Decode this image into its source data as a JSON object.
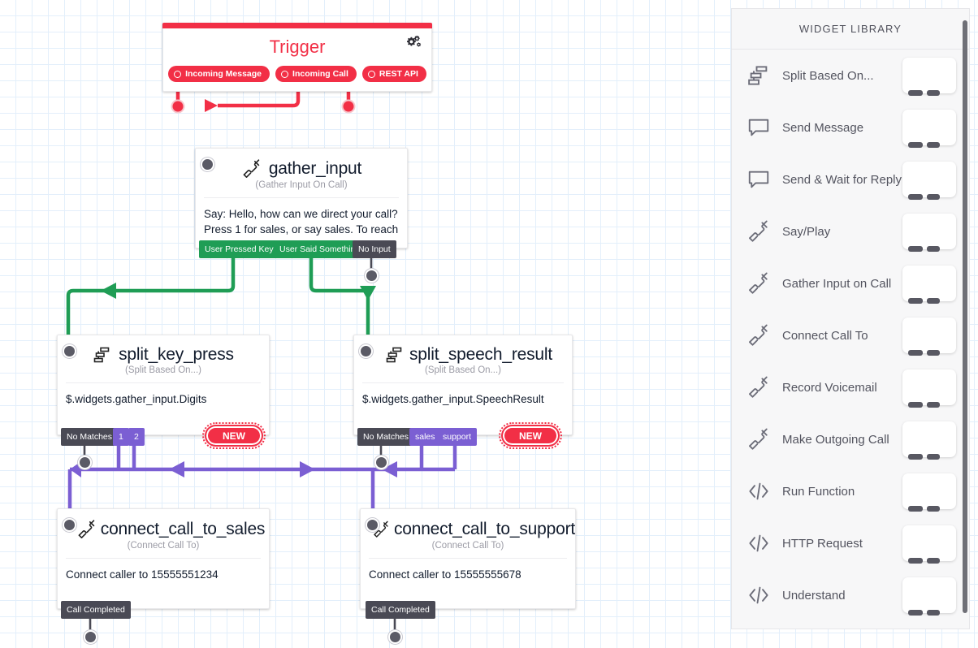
{
  "canvas": {
    "grid": true,
    "grid_color": "#e3effb",
    "background": "#ffffff"
  },
  "colors": {
    "trigger_red": "#f22f46",
    "green": "#1f9d55",
    "purple": "#7b5fd3",
    "dark_tab": "#4a4a55",
    "handle": "#5b5b66"
  },
  "trigger": {
    "title": "Trigger",
    "gear_icon": "gears-icon",
    "pills": [
      {
        "label": "Incoming Message",
        "icon": "circle-icon"
      },
      {
        "label": "Incoming Call",
        "icon": "circle-icon"
      },
      {
        "label": "REST API",
        "icon": "circle-icon"
      }
    ]
  },
  "nodes": {
    "gather_input": {
      "title": "gather_input",
      "subtitle": "(Gather Input On Call)",
      "icon": "phone-icon",
      "body": "Say: Hello, how can we direct your call? Press 1 for sales, or say sales. To reach",
      "outputs": [
        {
          "label": "User Pressed Keys",
          "color": "green"
        },
        {
          "label": "User Said Something",
          "color": "green"
        },
        {
          "label": "No Input",
          "color": "dark"
        }
      ]
    },
    "split_key_press": {
      "title": "split_key_press",
      "subtitle": "(Split Based On...)",
      "icon": "split-icon",
      "body": "$.widgets.gather_input.Digits",
      "outputs": [
        {
          "label": "No Matches",
          "color": "dark"
        },
        {
          "label": "1",
          "color": "purple"
        },
        {
          "label": "2",
          "color": "purple"
        }
      ],
      "new_button": "NEW"
    },
    "split_speech_result": {
      "title": "split_speech_result",
      "subtitle": "(Split Based On...)",
      "icon": "split-icon",
      "body": "$.widgets.gather_input.SpeechResult",
      "outputs": [
        {
          "label": "No Matches",
          "color": "dark"
        },
        {
          "label": "sales",
          "color": "purple"
        },
        {
          "label": "support",
          "color": "purple"
        }
      ],
      "new_button": "NEW"
    },
    "connect_call_to_sales": {
      "title": "connect_call_to_sales",
      "subtitle": "(Connect Call To)",
      "icon": "phone-icon",
      "body": "Connect caller to 15555551234",
      "outputs": [
        {
          "label": "Call Completed",
          "color": "dark"
        }
      ]
    },
    "connect_call_to_support": {
      "title": "connect_call_to_support",
      "subtitle": "(Connect Call To)",
      "icon": "phone-icon",
      "body": "Connect caller to 15555555678",
      "outputs": [
        {
          "label": "Call Completed",
          "color": "dark"
        }
      ]
    }
  },
  "library": {
    "header": "WIDGET LIBRARY",
    "items": [
      {
        "label": "Split Based On...",
        "icon": "split-icon"
      },
      {
        "label": "Send Message",
        "icon": "chat-bubble-icon"
      },
      {
        "label": "Send & Wait for Reply",
        "icon": "chat-bubble-icon"
      },
      {
        "label": "Say/Play",
        "icon": "phone-icon"
      },
      {
        "label": "Gather Input on Call",
        "icon": "phone-icon"
      },
      {
        "label": "Connect Call To",
        "icon": "phone-icon"
      },
      {
        "label": "Record Voicemail",
        "icon": "phone-icon"
      },
      {
        "label": "Make Outgoing Call",
        "icon": "phone-icon"
      },
      {
        "label": "Run Function",
        "icon": "code-icon"
      },
      {
        "label": "HTTP Request",
        "icon": "code-icon"
      },
      {
        "label": "Understand",
        "icon": "code-icon"
      }
    ]
  }
}
